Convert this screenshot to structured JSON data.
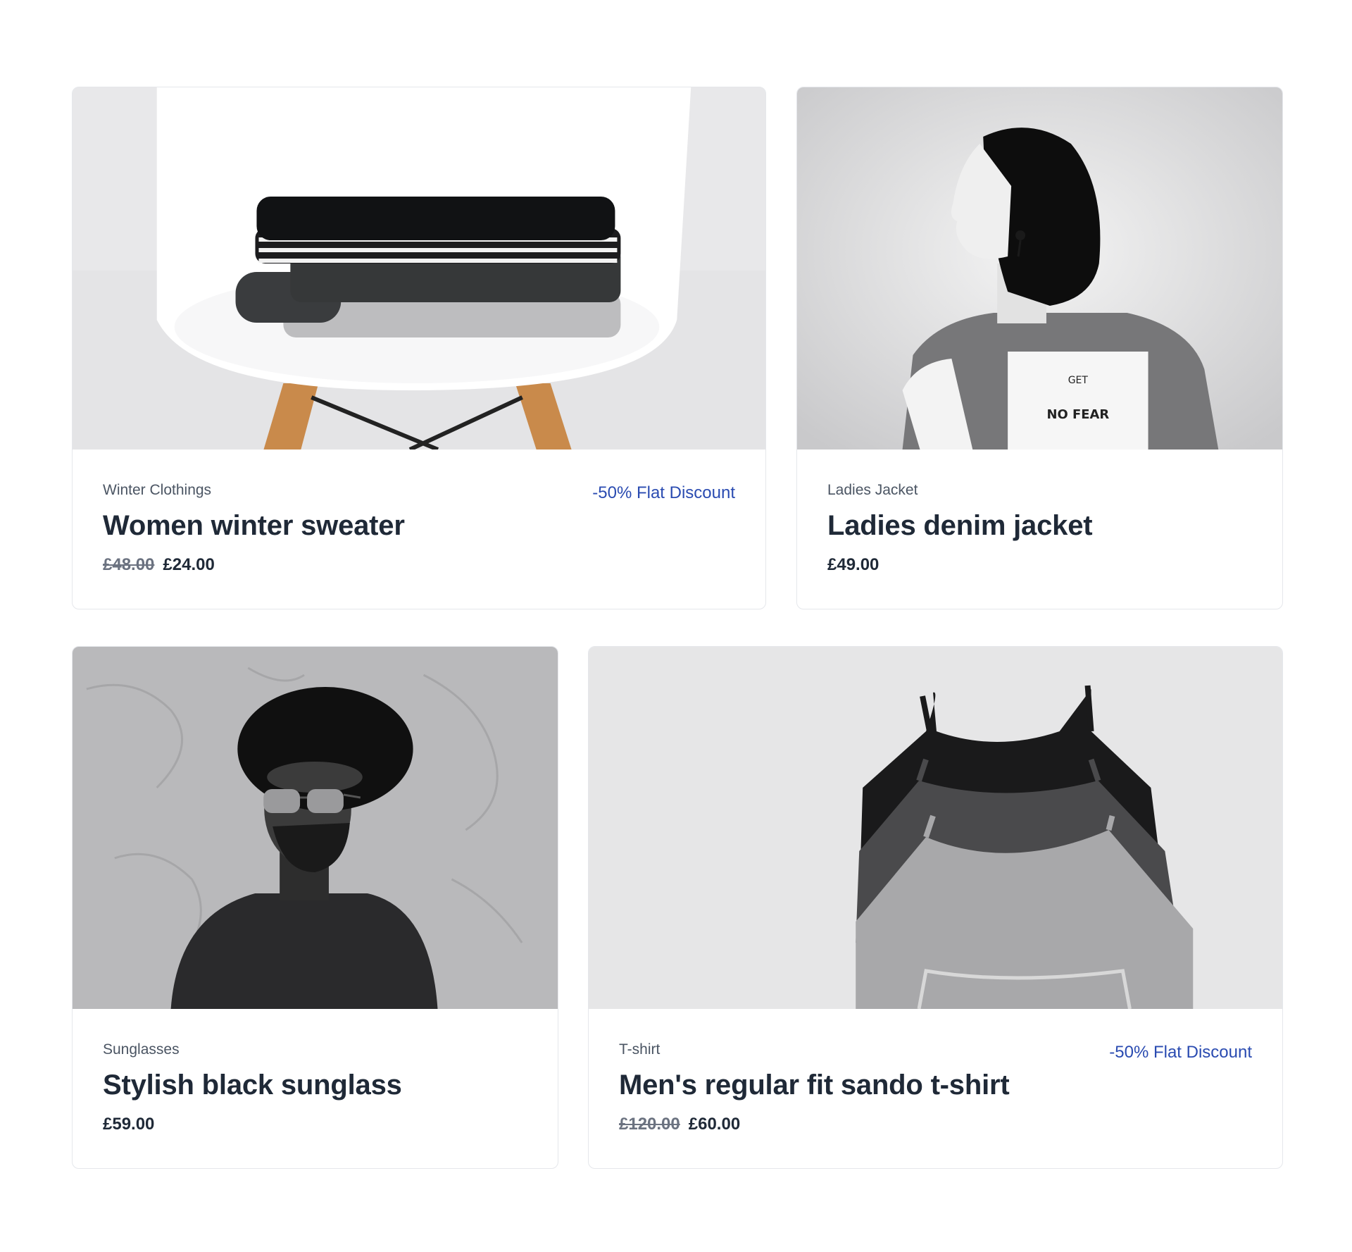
{
  "products": [
    {
      "category": "Winter Clothings",
      "title": "Women winter sweater",
      "old_price": "£48.00",
      "price": "£24.00",
      "discount": "-50% Flat Discount"
    },
    {
      "category": "Ladies Jacket",
      "title": "Ladies denim jacket",
      "price": "£49.00"
    },
    {
      "category": "Sunglasses",
      "title": "Stylish black sunglass",
      "price": "£59.00"
    },
    {
      "category": "T-shirt",
      "title": "Men's regular fit sando t-shirt",
      "old_price": "£120.00",
      "price": "£60.00",
      "discount": "-50% Flat Discount"
    }
  ],
  "colors": {
    "discount": "#2a4bb1",
    "border": "#e5e7eb",
    "text": "#1f2937",
    "muted": "#4b5563"
  }
}
